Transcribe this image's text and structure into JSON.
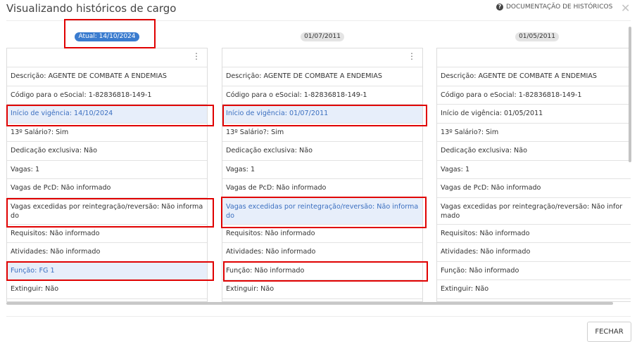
{
  "dialog": {
    "title": "Visualizando históricos de cargo",
    "doc_link": "DOCUMENTAÇÃO DE HISTÓRICOS",
    "close_button": "FECHAR"
  },
  "columns": [
    {
      "badge": "Atual: 14/10/2024",
      "rows": [
        "Descrição: AGENTE DE COMBATE A ENDEMIAS",
        "Código para o eSocial: 1-82836818-149-1",
        "Início de vigência: 14/10/2024",
        "13º Salário?: Sim",
        "Dedicação exclusiva: Não",
        "Vagas: 1",
        "Vagas de PcD: Não informado",
        "Vagas excedidas por reintegração/reversão: Não informado",
        "Requisitos: Não informado",
        "Atividades: Não informado",
        "Função: FG 1",
        "Extinguir: Não"
      ]
    },
    {
      "badge": "01/07/2011",
      "rows": [
        "Descrição: AGENTE DE COMBATE A ENDEMIAS",
        "Código para o eSocial: 1-82836818-149-1",
        "Início de vigência: 01/07/2011",
        "13º Salário?: Sim",
        "Dedicação exclusiva: Não",
        "Vagas: 1",
        "Vagas de PcD: Não informado",
        "Vagas excedidas por reintegração/reversão: Não informado",
        "Requisitos: Não informado",
        "Atividades: Não informado",
        "Função: Não informado",
        "Extinguir: Não"
      ]
    },
    {
      "badge": "01/05/2011",
      "rows": [
        "Descrição: AGENTE DE COMBATE A ENDEMIAS",
        "Código para o eSocial: 1-82836818-149-1",
        "Início de vigência: 01/05/2011",
        "13º Salário?: Sim",
        "Dedicação exclusiva: Não",
        "Vagas: 1",
        "Vagas de PcD: Não informado",
        "Vagas excedidas por reintegração/reversão: Não informado",
        "Requisitos: Não informado",
        "Atividades: Não informado",
        "Função: Não informado",
        "Extinguir: Não"
      ]
    }
  ],
  "colors": {
    "accent": "#3a7ccf",
    "highlight_bg": "#e7eefa",
    "annotation": "#e00000"
  }
}
